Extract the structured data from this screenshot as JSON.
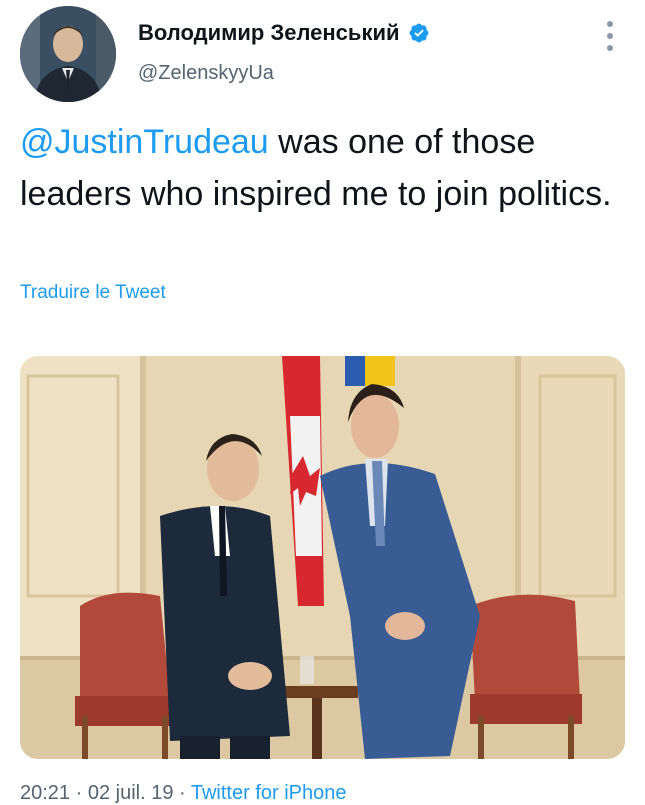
{
  "header": {
    "display_name": "Володимир Зеленський",
    "handle": "@ZelenskyyUa",
    "verified_icon": "verified-badge-icon",
    "more_icon": "more-vertical-icon",
    "avatar_icon": "user-avatar"
  },
  "tweet": {
    "mention": "@JustinTrudeau",
    "text": " was one of those leaders who inspired me to join politics.",
    "translate_label": "Traduire le Tweet"
  },
  "footer": {
    "timestamp": "20:21 · 02 juil. 19 · ",
    "source": "Twitter for iPhone"
  },
  "colors": {
    "link": "#1d9bf0",
    "secondary": "#536471",
    "primary_text": "#0f1419"
  }
}
